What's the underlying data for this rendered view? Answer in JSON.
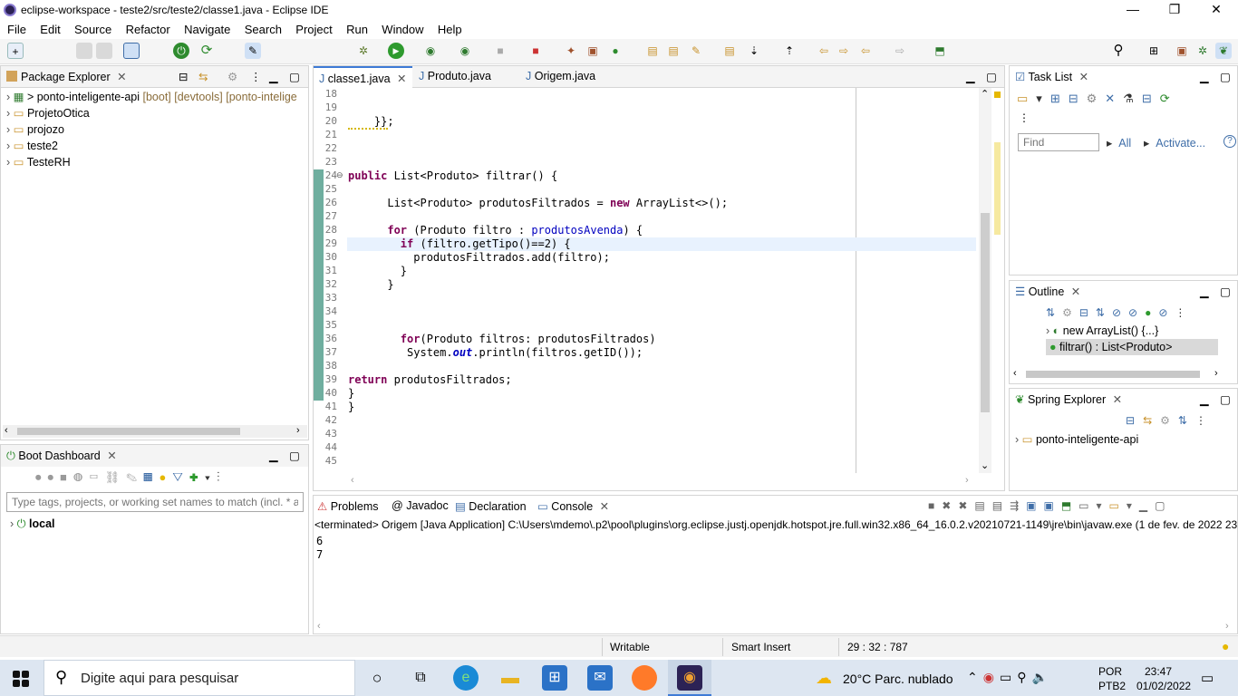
{
  "window": {
    "title": "eclipse-workspace - teste2/src/teste2/classe1.java - Eclipse IDE",
    "minimize": "—",
    "restore": "❐",
    "close": "✕"
  },
  "menu": [
    "File",
    "Edit",
    "Source",
    "Refactor",
    "Navigate",
    "Search",
    "Project",
    "Run",
    "Window",
    "Help"
  ],
  "package_explorer": {
    "title": "Package Explorer",
    "items": [
      {
        "label": "> ponto-inteligente-api",
        "extra": "[boot] [devtools] [ponto-intelige"
      },
      {
        "label": "ProjetoOtica",
        "extra": ""
      },
      {
        "label": "projozo",
        "extra": ""
      },
      {
        "label": "teste2",
        "extra": ""
      },
      {
        "label": "TesteRH",
        "extra": ""
      }
    ]
  },
  "boot_dashboard": {
    "title": "Boot Dashboard",
    "filter_placeholder": "Type tags, projects, or working set names to match (incl. * an",
    "items": [
      "local"
    ]
  },
  "editor": {
    "tabs": [
      "classe1.java",
      "Produto.java",
      "Origem.java"
    ],
    "line_numbers": [
      "18",
      "19",
      "20",
      "21",
      "22",
      "23",
      "24",
      "25",
      "26",
      "27",
      "28",
      "29",
      "30",
      "31",
      "32",
      "33",
      "34",
      "35",
      "36",
      "37",
      "38",
      "39",
      "40",
      "41",
      "42",
      "43",
      "44",
      "45"
    ],
    "code": [
      {
        "n": "20",
        "p": [
          "    ",
          "}};"
        ]
      },
      {
        "n": "24",
        "p": [
          "public List<Produto> filtrar() {"
        ]
      },
      {
        "n": "26",
        "p": [
          "      List<Produto> produtosFiltrados = new ArrayList<>();"
        ]
      },
      {
        "n": "28",
        "p": [
          "      for (Produto filtro : produtosAvenda) {"
        ]
      },
      {
        "n": "29",
        "p": [
          "        if (filtro.getTipo()==2) {"
        ]
      },
      {
        "n": "30",
        "p": [
          "          produtosFiltrados.add(filtro);"
        ]
      },
      {
        "n": "31",
        "p": [
          "        }"
        ]
      },
      {
        "n": "32",
        "p": [
          "      }"
        ]
      },
      {
        "n": "36",
        "p": [
          "        for(Produto filtros: produtosFiltrados)"
        ]
      },
      {
        "n": "37",
        "p": [
          "         System.out.println(filtros.getID());"
        ]
      },
      {
        "n": "39",
        "p": [
          "return produtosFiltrados;"
        ]
      },
      {
        "n": "40",
        "p": [
          "}"
        ]
      },
      {
        "n": "41",
        "p": [
          "}"
        ]
      }
    ]
  },
  "task_list": {
    "title": "Task List",
    "find_placeholder": "Find",
    "all": "All",
    "activate": "Activate..."
  },
  "outline": {
    "title": "Outline",
    "items": [
      "new ArrayList() {...}",
      "filtrar() : List<Produto>"
    ]
  },
  "spring_explorer": {
    "title": "Spring Explorer",
    "items": [
      "ponto-inteligente-api"
    ]
  },
  "bottom_tabs": [
    "Problems",
    "Javadoc",
    "Declaration",
    "Console"
  ],
  "console": {
    "header": "<terminated> Origem [Java Application] C:\\Users\\mdemo\\.p2\\pool\\plugins\\org.eclipse.justj.openjdk.hotspot.jre.full.win32.x86_64_16.0.2.v20210721-1149\\jre\\bin\\javaw.exe  (1 de fev. de 2022 23:",
    "lines": [
      "6",
      "7"
    ]
  },
  "status": {
    "writable": "Writable",
    "insert": "Smart Insert",
    "position": "29 : 32 : 787"
  },
  "taskbar": {
    "search_placeholder": "Digite aqui para pesquisar",
    "weather": "20°C  Parc. nublado",
    "lang1": "POR",
    "lang2": "PTB2",
    "time": "23:47",
    "date": "01/02/2022"
  },
  "colors": {
    "keyword": "#7f0055",
    "field": "#0000c0",
    "accent": "#3f7bd6"
  }
}
